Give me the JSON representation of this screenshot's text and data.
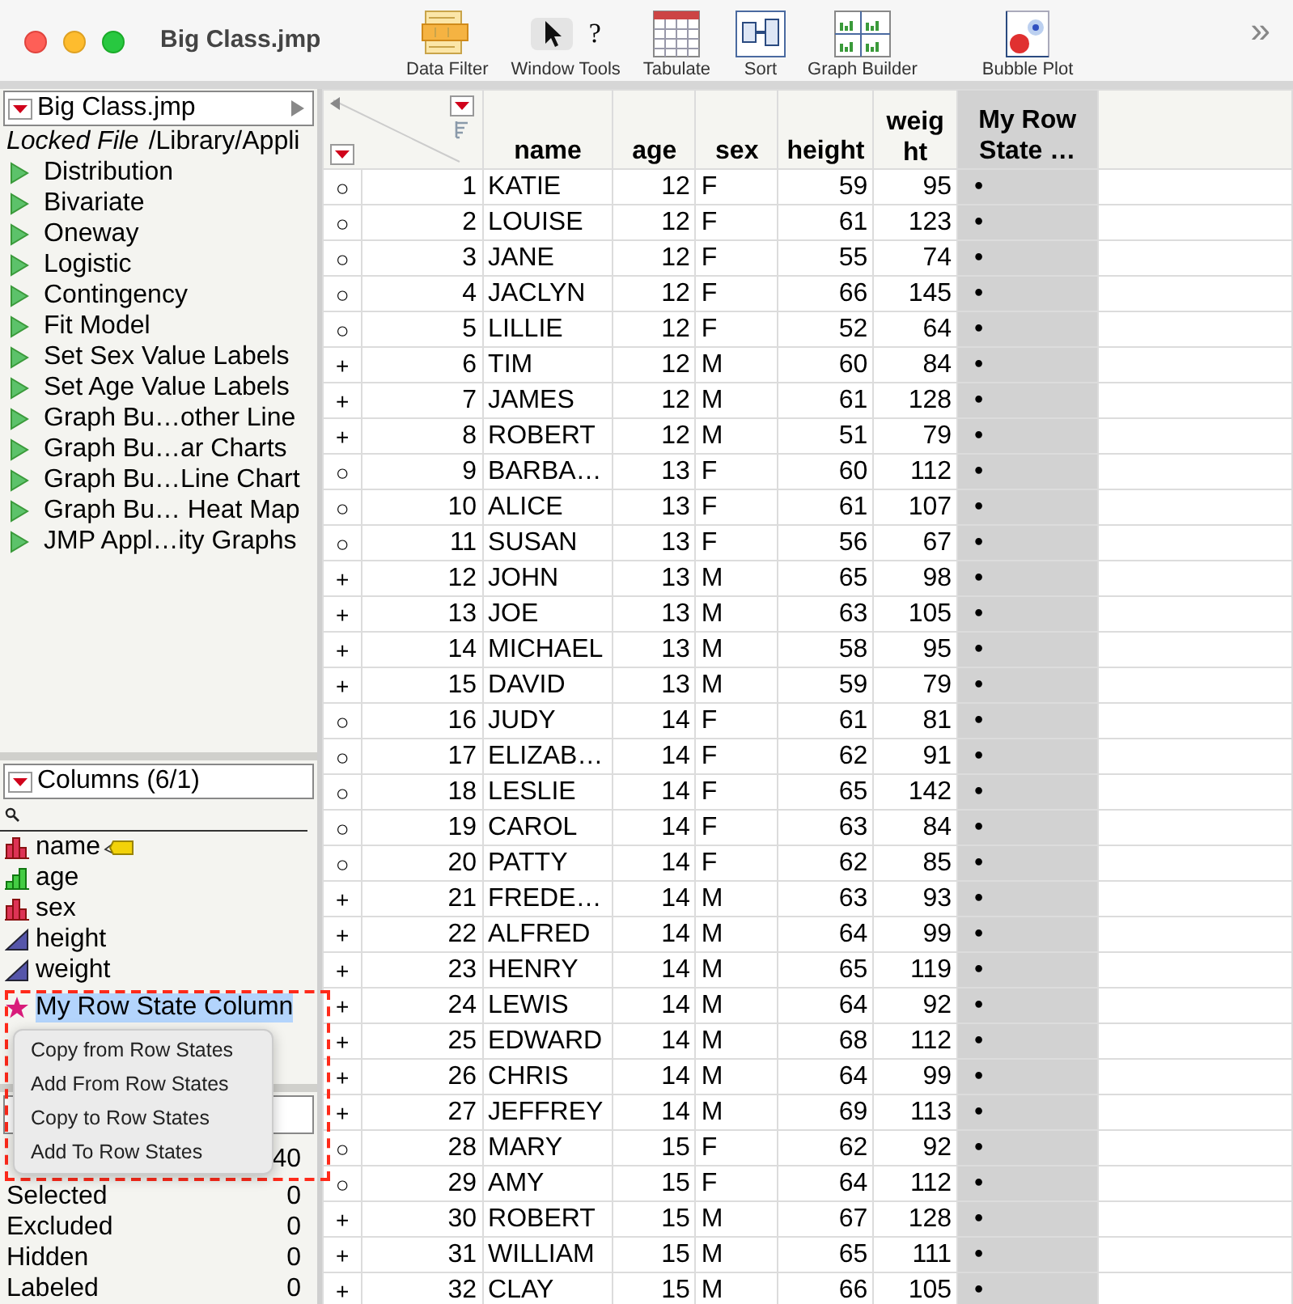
{
  "window": {
    "title": "Big Class.jmp"
  },
  "toolbar": [
    {
      "label": "Data Filter",
      "kind": "filter"
    },
    {
      "label": "Window Tools",
      "kind": "tools",
      "help_glyph": "?"
    },
    {
      "label": "Tabulate",
      "kind": "tabulate"
    },
    {
      "label": "Sort",
      "kind": "sort"
    },
    {
      "label": "Graph Builder",
      "kind": "graph"
    },
    {
      "label": "Bubble Plot",
      "kind": "bubble"
    }
  ],
  "toolbar_overflow": "»",
  "table_panel": {
    "title": "Big Class.jmp",
    "locked_label": "Locked File",
    "path": "/Library/Appli",
    "scripts": [
      "Distribution",
      "Bivariate",
      "Oneway",
      "Logistic",
      "Contingency",
      "Fit Model",
      "Set Sex Value Labels",
      "Set Age Value Labels",
      "Graph Bu…other Line",
      "Graph Bu…ar Charts",
      "Graph Bu…Line Chart",
      "Graph Bu… Heat Map",
      "JMP Appl…ity Graphs"
    ]
  },
  "columns_panel": {
    "title": "Columns (6/1)",
    "columns": [
      {
        "name": "name",
        "kind": "nominal",
        "labeled": true,
        "selected": false
      },
      {
        "name": "age",
        "kind": "ordinal",
        "labeled": false,
        "selected": false
      },
      {
        "name": "sex",
        "kind": "nominal",
        "labeled": false,
        "selected": false
      },
      {
        "name": "height",
        "kind": "continuous",
        "labeled": false,
        "selected": false
      },
      {
        "name": "weight",
        "kind": "continuous",
        "labeled": false,
        "selected": false
      },
      {
        "name": "My Row State Column",
        "kind": "rowstate",
        "labeled": false,
        "selected": true
      }
    ]
  },
  "rows_panel": {
    "all_rows_count": "40",
    "items": [
      {
        "label": "Selected",
        "count": "0"
      },
      {
        "label": "Excluded",
        "count": "0"
      },
      {
        "label": "Hidden",
        "count": "0"
      },
      {
        "label": "Labeled",
        "count": "0"
      }
    ]
  },
  "context_menu": {
    "items": [
      "Copy from Row States",
      "Add From Row States",
      "Copy to Row States",
      "Add To Row States"
    ]
  },
  "table": {
    "columns": [
      {
        "label": "name",
        "kind": "character",
        "selected": false
      },
      {
        "label": "age",
        "kind": "numeric",
        "selected": false
      },
      {
        "label": "sex",
        "kind": "character",
        "selected": false
      },
      {
        "label": "height",
        "kind": "numeric",
        "selected": false
      },
      {
        "label": "weight",
        "kind": "numeric",
        "selected": false
      },
      {
        "label": "My Row State …",
        "kind": "rowstate",
        "selected": true
      }
    ],
    "rows": [
      {
        "marker": "○",
        "row": "1",
        "cells": [
          "KATIE",
          "12",
          "F",
          "59",
          "95",
          "•"
        ]
      },
      {
        "marker": "○",
        "row": "2",
        "cells": [
          "LOUISE",
          "12",
          "F",
          "61",
          "123",
          "•"
        ]
      },
      {
        "marker": "○",
        "row": "3",
        "cells": [
          "JANE",
          "12",
          "F",
          "55",
          "74",
          "•"
        ]
      },
      {
        "marker": "○",
        "row": "4",
        "cells": [
          "JACLYN",
          "12",
          "F",
          "66",
          "145",
          "•"
        ]
      },
      {
        "marker": "○",
        "row": "5",
        "cells": [
          "LILLIE",
          "12",
          "F",
          "52",
          "64",
          "•"
        ]
      },
      {
        "marker": "+",
        "row": "6",
        "cells": [
          "TIM",
          "12",
          "M",
          "60",
          "84",
          "•"
        ]
      },
      {
        "marker": "+",
        "row": "7",
        "cells": [
          "JAMES",
          "12",
          "M",
          "61",
          "128",
          "•"
        ]
      },
      {
        "marker": "+",
        "row": "8",
        "cells": [
          "ROBERT",
          "12",
          "M",
          "51",
          "79",
          "•"
        ]
      },
      {
        "marker": "○",
        "row": "9",
        "cells": [
          "BARBA…",
          "13",
          "F",
          "60",
          "112",
          "•"
        ]
      },
      {
        "marker": "○",
        "row": "10",
        "cells": [
          "ALICE",
          "13",
          "F",
          "61",
          "107",
          "•"
        ]
      },
      {
        "marker": "○",
        "row": "11",
        "cells": [
          "SUSAN",
          "13",
          "F",
          "56",
          "67",
          "•"
        ]
      },
      {
        "marker": "+",
        "row": "12",
        "cells": [
          "JOHN",
          "13",
          "M",
          "65",
          "98",
          "•"
        ]
      },
      {
        "marker": "+",
        "row": "13",
        "cells": [
          "JOE",
          "13",
          "M",
          "63",
          "105",
          "•"
        ]
      },
      {
        "marker": "+",
        "row": "14",
        "cells": [
          "MICHAEL",
          "13",
          "M",
          "58",
          "95",
          "•"
        ]
      },
      {
        "marker": "+",
        "row": "15",
        "cells": [
          "DAVID",
          "13",
          "M",
          "59",
          "79",
          "•"
        ]
      },
      {
        "marker": "○",
        "row": "16",
        "cells": [
          "JUDY",
          "14",
          "F",
          "61",
          "81",
          "•"
        ]
      },
      {
        "marker": "○",
        "row": "17",
        "cells": [
          "ELIZAB…",
          "14",
          "F",
          "62",
          "91",
          "•"
        ]
      },
      {
        "marker": "○",
        "row": "18",
        "cells": [
          "LESLIE",
          "14",
          "F",
          "65",
          "142",
          "•"
        ]
      },
      {
        "marker": "○",
        "row": "19",
        "cells": [
          "CAROL",
          "14",
          "F",
          "63",
          "84",
          "•"
        ]
      },
      {
        "marker": "○",
        "row": "20",
        "cells": [
          "PATTY",
          "14",
          "F",
          "62",
          "85",
          "•"
        ]
      },
      {
        "marker": "+",
        "row": "21",
        "cells": [
          "FREDE…",
          "14",
          "M",
          "63",
          "93",
          "•"
        ]
      },
      {
        "marker": "+",
        "row": "22",
        "cells": [
          "ALFRED",
          "14",
          "M",
          "64",
          "99",
          "•"
        ]
      },
      {
        "marker": "+",
        "row": "23",
        "cells": [
          "HENRY",
          "14",
          "M",
          "65",
          "119",
          "•"
        ]
      },
      {
        "marker": "+",
        "row": "24",
        "cells": [
          "LEWIS",
          "14",
          "M",
          "64",
          "92",
          "•"
        ]
      },
      {
        "marker": "+",
        "row": "25",
        "cells": [
          "EDWARD",
          "14",
          "M",
          "68",
          "112",
          "•"
        ]
      },
      {
        "marker": "+",
        "row": "26",
        "cells": [
          "CHRIS",
          "14",
          "M",
          "64",
          "99",
          "•"
        ]
      },
      {
        "marker": "+",
        "row": "27",
        "cells": [
          "JEFFREY",
          "14",
          "M",
          "69",
          "113",
          "•"
        ]
      },
      {
        "marker": "○",
        "row": "28",
        "cells": [
          "MARY",
          "15",
          "F",
          "62",
          "92",
          "•"
        ]
      },
      {
        "marker": "○",
        "row": "29",
        "cells": [
          "AMY",
          "15",
          "F",
          "64",
          "112",
          "•"
        ]
      },
      {
        "marker": "+",
        "row": "30",
        "cells": [
          "ROBERT",
          "15",
          "M",
          "67",
          "128",
          "•"
        ]
      },
      {
        "marker": "+",
        "row": "31",
        "cells": [
          "WILLIAM",
          "15",
          "M",
          "65",
          "111",
          "•"
        ]
      },
      {
        "marker": "+",
        "row": "32",
        "cells": [
          "CLAY",
          "15",
          "M",
          "66",
          "105",
          "•"
        ]
      }
    ]
  }
}
